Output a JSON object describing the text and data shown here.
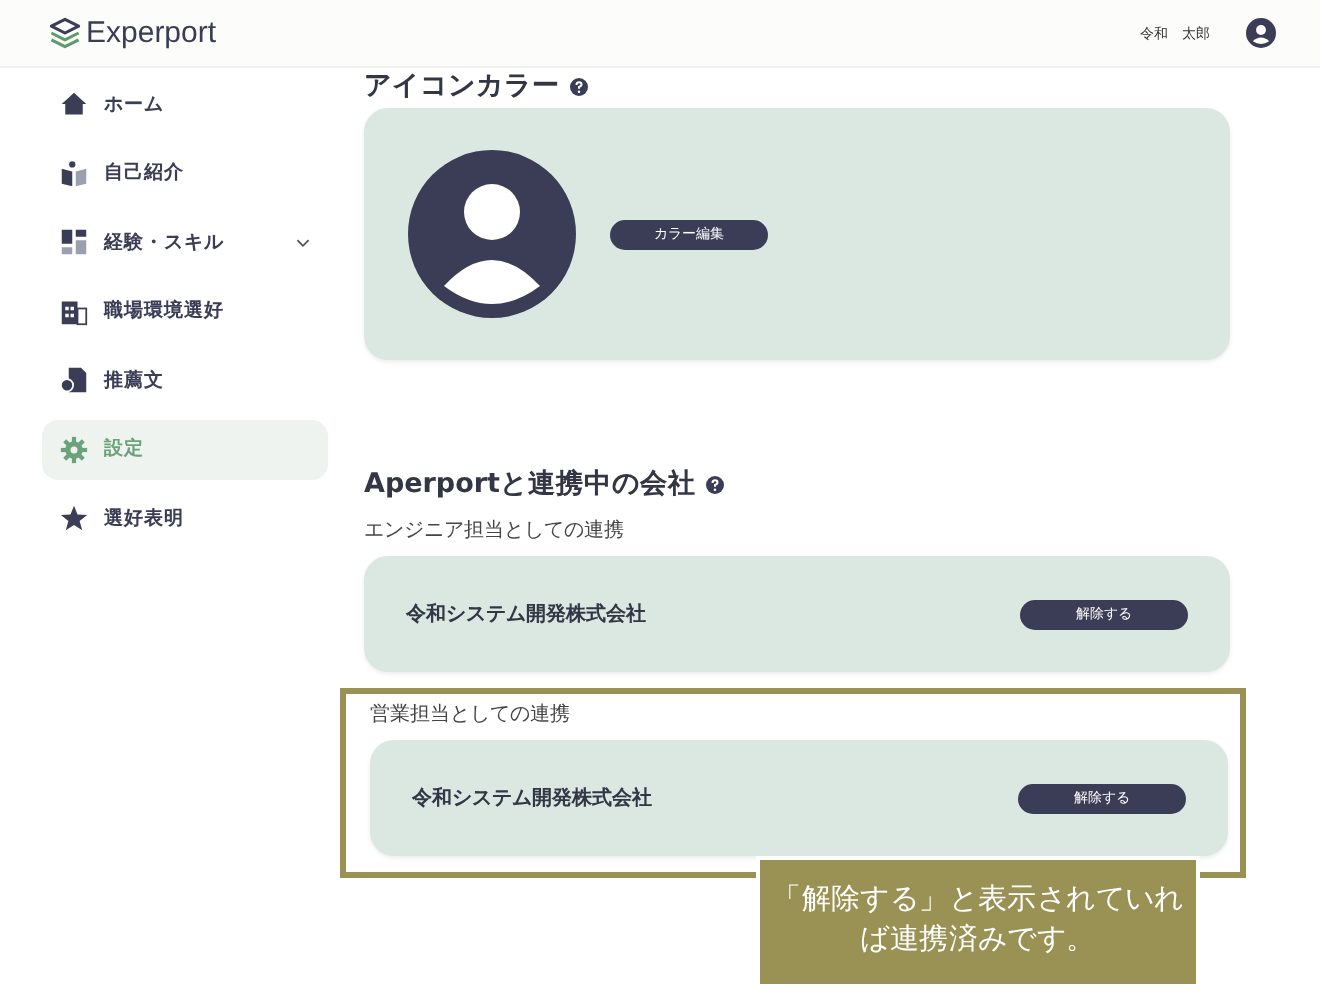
{
  "header": {
    "logo": "Experport",
    "user_name": "令和　太郎"
  },
  "sidebar": {
    "items": [
      {
        "label": "ホーム",
        "kind": "link",
        "selected": false
      },
      {
        "label": "自己紹介",
        "kind": "link",
        "selected": false
      },
      {
        "label": "経験・スキル",
        "kind": "group",
        "expanded": false,
        "selected": false
      },
      {
        "label": "職場環境選好",
        "kind": "link",
        "selected": false
      },
      {
        "label": "推薦文",
        "kind": "link",
        "selected": false
      },
      {
        "label": "設定",
        "kind": "link",
        "selected": true
      },
      {
        "label": "選好表明",
        "kind": "link",
        "selected": false
      }
    ]
  },
  "icon_color": {
    "title": "アイコンカラー",
    "edit_button": "カラー編集"
  },
  "linked_companies": {
    "title": "Aperportと連携中の会社",
    "groups": [
      {
        "label": "エンジニア担当としての連携",
        "highlighted": false,
        "company": "令和システム開発株式会社",
        "button": "解除する"
      },
      {
        "label": "営業担当としての連携",
        "highlighted": true,
        "company": "令和システム開発株式会社",
        "button": "解除する"
      }
    ]
  },
  "callout": "「解除する」と表示されていれば連携済みです。"
}
